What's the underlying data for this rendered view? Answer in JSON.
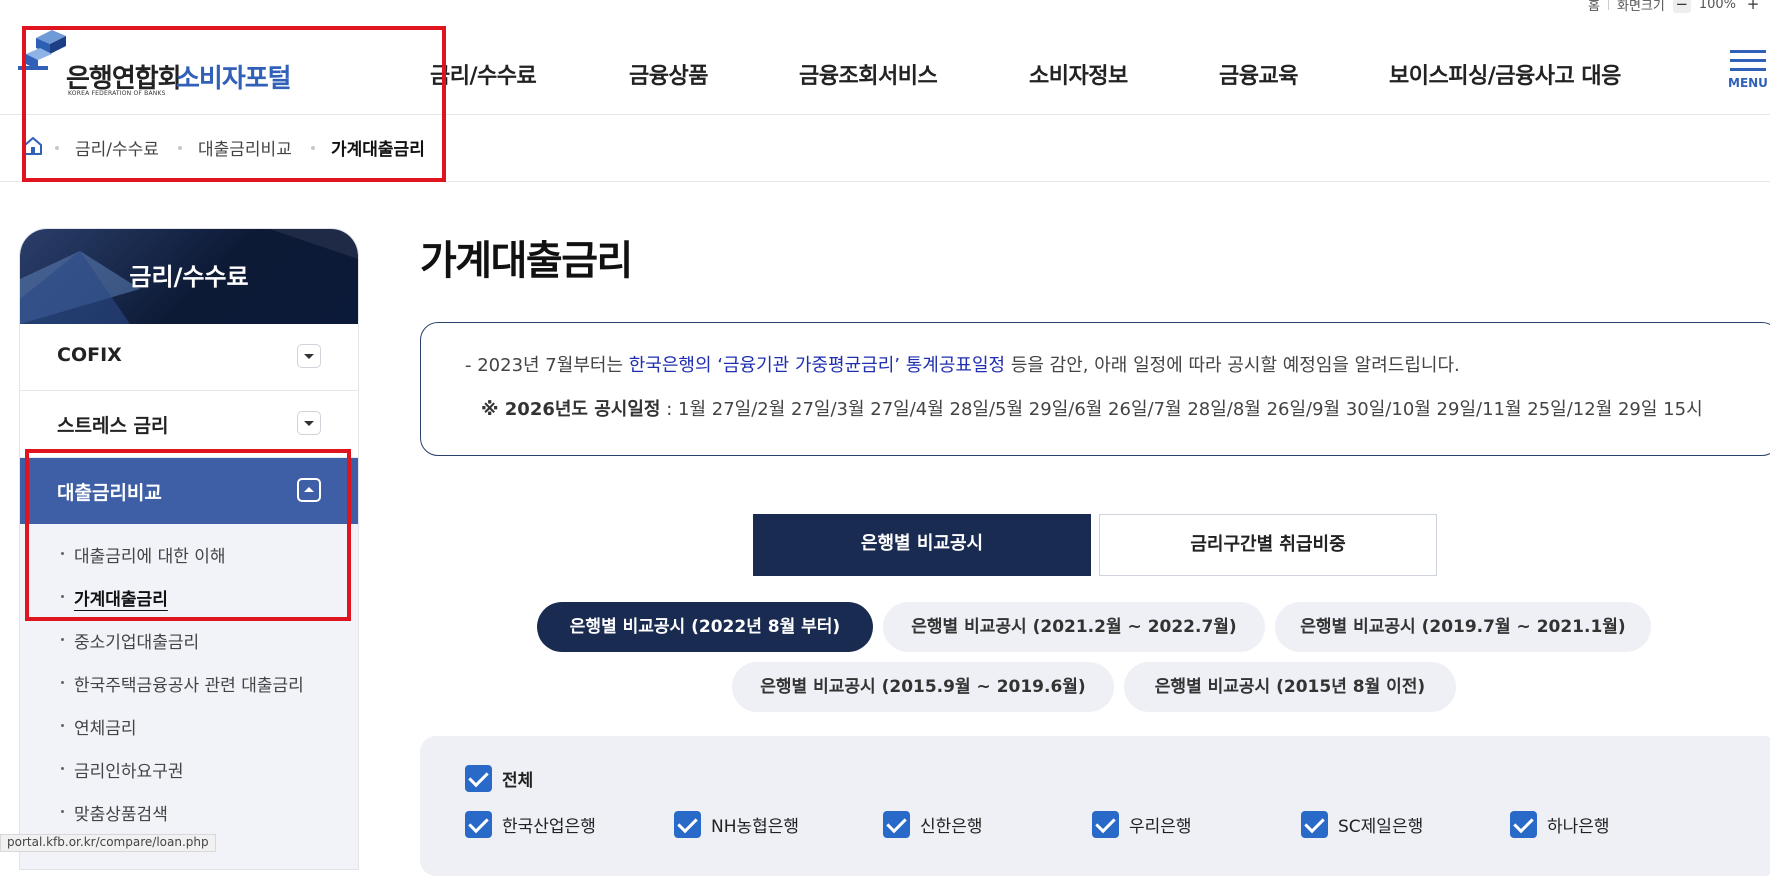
{
  "util": {
    "home": "홈",
    "zoom_label": "화면크기",
    "zoom_minus": "−",
    "zoom_value": "100%",
    "zoom_plus": "+"
  },
  "logo": {
    "main": "은행연합회",
    "sub": "소비자포털",
    "eng": "KOREA FEDERATION OF BANKS"
  },
  "gnb": [
    "금리/수수료",
    "금융상품",
    "금융조회서비스",
    "소비자정보",
    "금융교육",
    "보이스피싱/금융사고 대응"
  ],
  "menu_label": "MENU",
  "breadcrumb": [
    "금리/수수료",
    "대출금리비교",
    "가계대출금리"
  ],
  "lnb": {
    "title": "금리/수수료",
    "items": [
      "COFIX",
      "스트레스 금리",
      "대출금리비교"
    ],
    "sub": [
      "대출금리에 대한 이해",
      "가계대출금리",
      "중소기업대출금리",
      "한국주택금융공사 관련 대출금리",
      "연체금리",
      "금리인하요구권",
      "맞춤상품검색"
    ]
  },
  "page_title": "가계대출금리",
  "notice": {
    "l1_pre": "- 2023년 7월부터는 ",
    "l1_highlight": "한국은행의 ‘금융기관 가중평균금리’ 통계공표일정",
    "l1_post": " 등을 감안, 아래 일정에 따라 공시할 예정임을 알려드립니다.",
    "l2_bold": "※ 2026년도 공시일정",
    "l2_rest": " : 1월 27일/2월 27일/3월 27일/4월 28일/5월 29일/6월 26일/7월 28일/8월 26일/9월 30일/10월 29일/11월 25일/12월 29일 15시"
  },
  "tabs": [
    "은행별 비교공시",
    "금리구간별 취급비중"
  ],
  "periods": [
    "은행별 비교공시 (2022년 8월 부터)",
    "은행별 비교공시 (2021.2월 ~ 2022.7월)",
    "은행별 비교공시 (2019.7월 ~ 2021.1월)",
    "은행별 비교공시 (2015.9월 ~ 2019.6월)",
    "은행별 비교공시 (2015년 8월 이전)"
  ],
  "filter": {
    "all": "전체",
    "banks": [
      "한국산업은행",
      "NH농협은행",
      "신한은행",
      "우리은행",
      "SC제일은행",
      "하나은행"
    ]
  },
  "status_url": "portal.kfb.or.kr/compare/loan.php",
  "colors": {
    "brand": "#3160b8",
    "navy": "#1a2b52",
    "highlight": "#e0141e",
    "checkbox": "#2969c7"
  }
}
